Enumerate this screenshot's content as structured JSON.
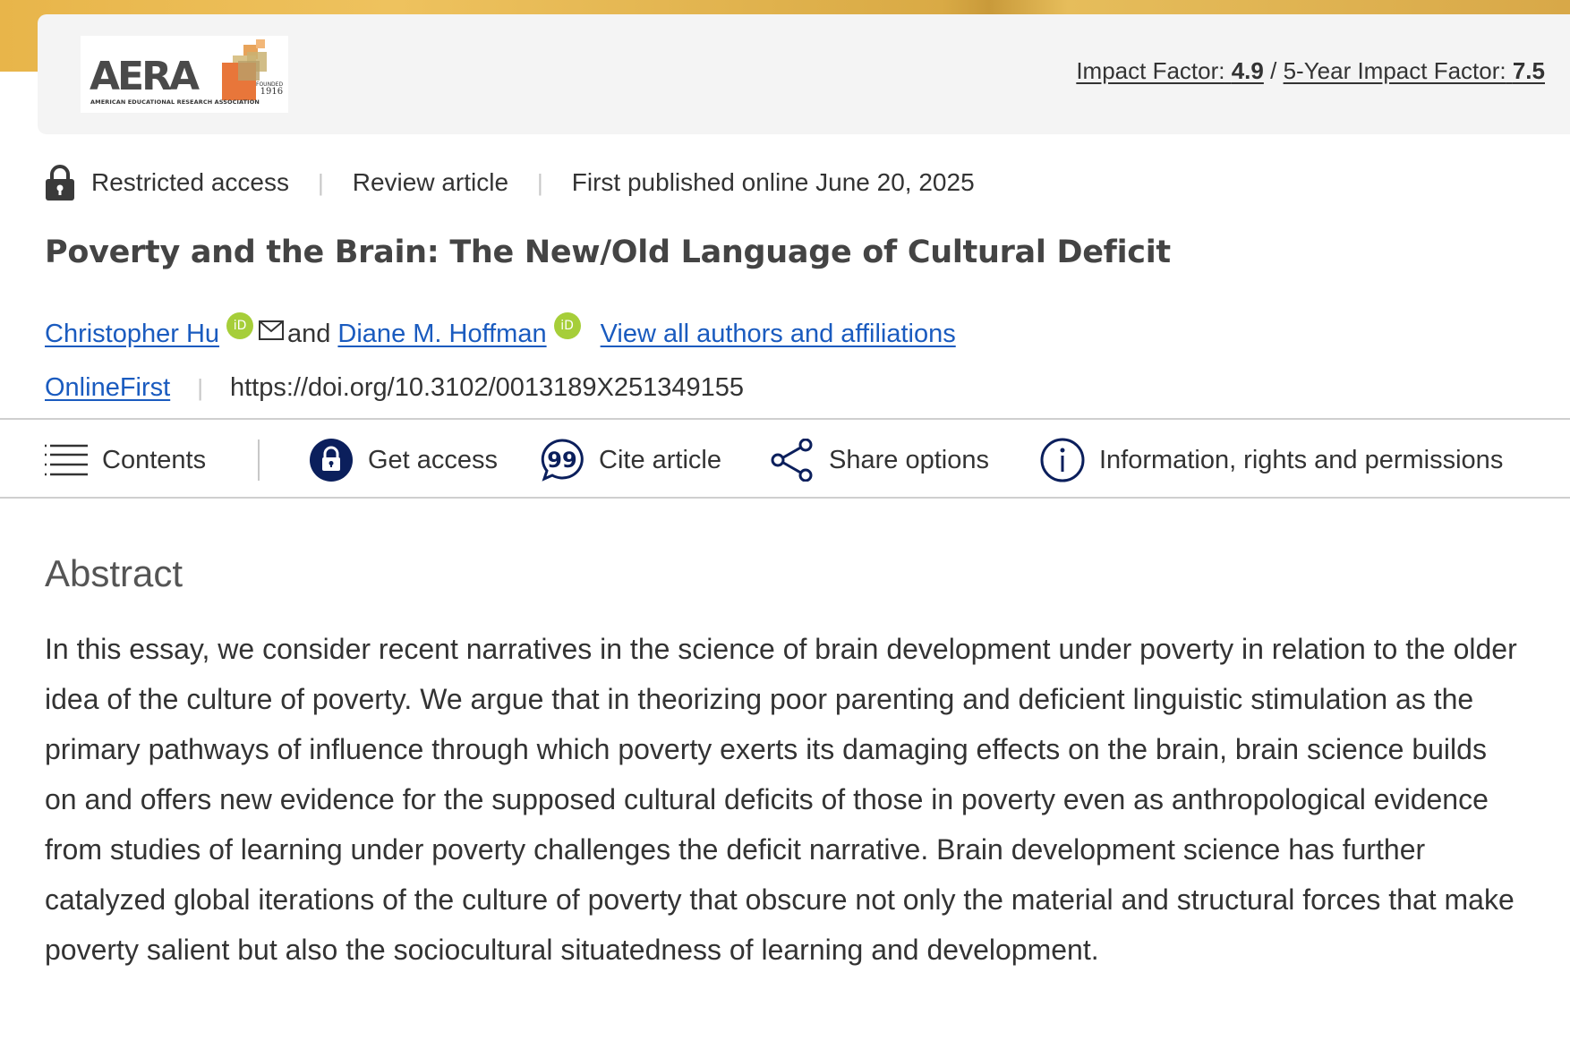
{
  "journal": {
    "logo_text": "AERA",
    "logo_subtitle": "AMERICAN EDUCATIONAL RESEARCH ASSOCIATION",
    "logo_founded_label": "FOUNDED",
    "logo_founded_year": "1916",
    "impact_factor_label": "Impact Factor:",
    "impact_factor_value": "4.9",
    "separator": "/",
    "five_year_label": "5-Year Impact Factor:",
    "five_year_value": "7.5",
    "brand_gold": "#e8b54a"
  },
  "article_meta": {
    "access": "Restricted access",
    "type": "Review article",
    "published": "First published online June 20, 2025"
  },
  "article": {
    "title": "Poverty and the Brain: The New/Old Language of Cultural Deficit",
    "authors": [
      {
        "name": "Christopher Hu",
        "orcid_label": "iD"
      },
      {
        "name": "Diane M. Hoffman",
        "orcid_label": "iD"
      }
    ],
    "author_join": "and",
    "view_all_link": "View all authors and affiliations",
    "collection": "OnlineFirst",
    "doi": "https://doi.org/10.3102/0013189X251349155"
  },
  "toolbar": {
    "contents": "Contents",
    "get_access": "Get access",
    "cite": "Cite article",
    "share": "Share options",
    "info": "Information, rights and permissions"
  },
  "abstract": {
    "heading": "Abstract",
    "body": "In this essay, we consider recent narratives in the science of brain development under poverty in relation to the older idea of the culture of poverty. We argue that in theorizing poor parenting and deficient linguistic stimulation as the primary pathways of influence through which poverty exerts its damaging effects on the brain, brain science builds on and offers new evidence for the supposed cultural deficits of those in poverty even as anthropological evidence from studies of learning under poverty challenges the deficit narrative. Brain development science has further catalyzed global iterations of the culture of poverty that obscure not only the material and structural forces that make poverty salient but also the sociocultural situatedness of learning and development."
  },
  "colors": {
    "link": "#1a5bbf",
    "icon_navy": "#0b1f5c",
    "orcid_green": "#a6ce39"
  }
}
